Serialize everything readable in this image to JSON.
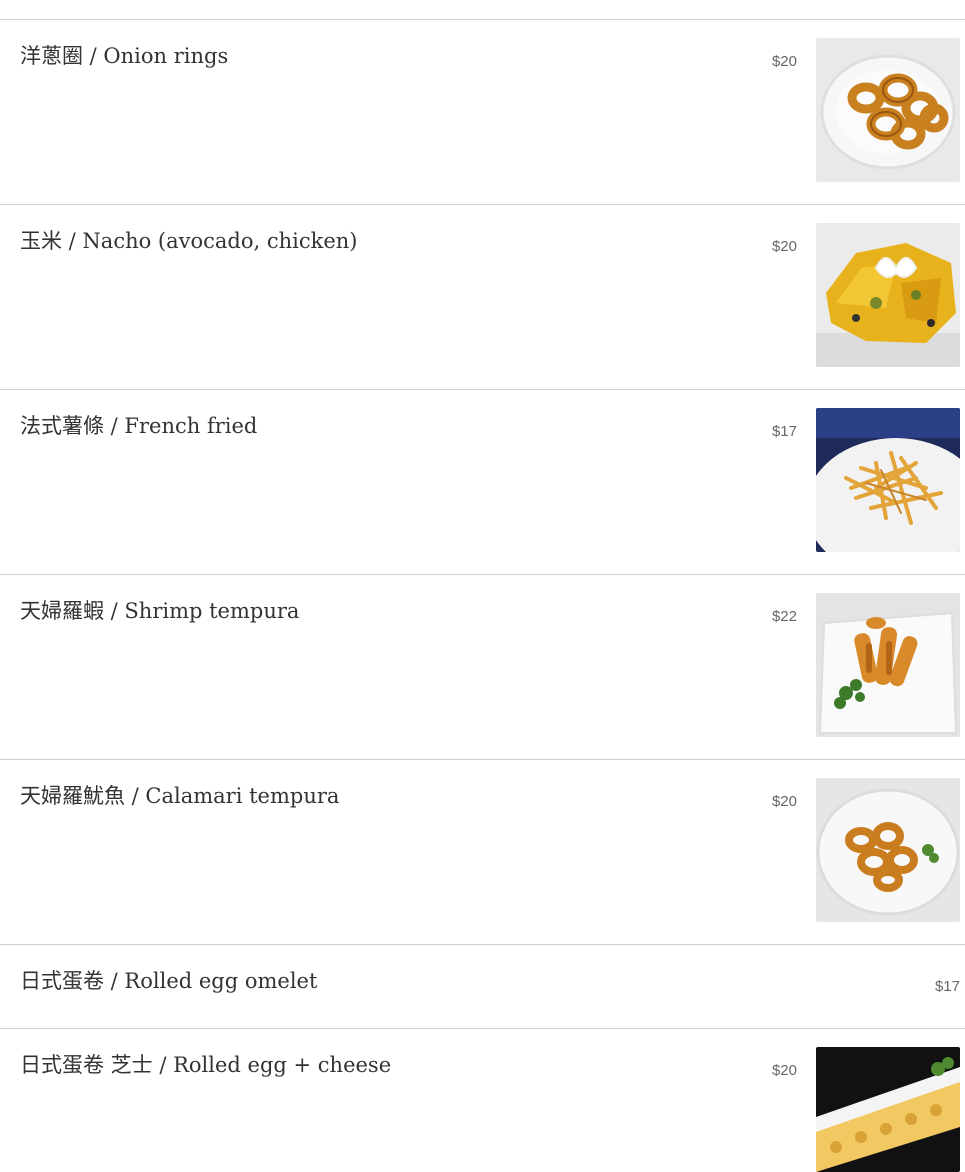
{
  "menu": {
    "items": [
      {
        "name": "洋蔥圈 / Onion rings",
        "price": "$20",
        "image": "onion-rings-photo"
      },
      {
        "name": "玉米 / Nacho (avocado, chicken)",
        "price": "$20",
        "image": "nacho-photo"
      },
      {
        "name": "法式薯條 / French fried",
        "price": "$17",
        "image": "french-fries-photo"
      },
      {
        "name": "天婦羅蝦 / Shrimp tempura",
        "price": "$22",
        "image": "shrimp-tempura-photo"
      },
      {
        "name": "天婦羅魷魚 / Calamari tempura",
        "price": "$20",
        "image": "calamari-tempura-photo"
      },
      {
        "name": "日式蛋卷 / Rolled egg omelet",
        "price": "$17"
      },
      {
        "name": "日式蛋卷 芝士 / Rolled egg + cheese",
        "price": "$20",
        "image": "rolled-egg-cheese-photo"
      }
    ]
  }
}
